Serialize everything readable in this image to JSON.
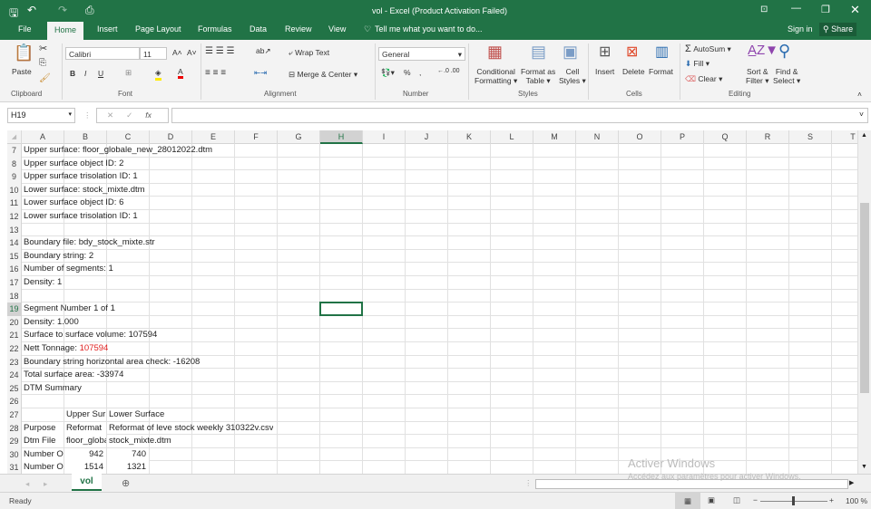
{
  "window": {
    "title": "vol - Excel (Product Activation Failed)"
  },
  "tabs": [
    "File",
    "Home",
    "Insert",
    "Page Layout",
    "Formulas",
    "Data",
    "Review",
    "View"
  ],
  "tell_me": "Tell me what you want to do...",
  "sign_in": "Sign in",
  "share": "Share",
  "ribbon": {
    "clipboard": {
      "paste": "Paste",
      "label": "Clipboard"
    },
    "font": {
      "name": "Calibri",
      "size": "11",
      "bold": "B",
      "italic": "I",
      "underline": "U",
      "label": "Font"
    },
    "alignment": {
      "wrap": "Wrap Text",
      "merge": "Merge & Center",
      "label": "Alignment"
    },
    "number": {
      "format": "General",
      "percent": "%",
      "comma": ",",
      "label": "Number"
    },
    "styles": {
      "conditional": "Conditional",
      "conditional2": "Formatting",
      "format_table": "Format as",
      "format_table2": "Table",
      "cell_styles": "Cell",
      "cell_styles2": "Styles",
      "label": "Styles"
    },
    "cells": {
      "insert": "Insert",
      "delete": "Delete",
      "format": "Format",
      "label": "Cells"
    },
    "editing": {
      "autosum": "AutoSum",
      "fill": "Fill",
      "clear": "Clear",
      "sort": "Sort &",
      "sort2": "Filter",
      "find": "Find &",
      "find2": "Select",
      "label": "Editing"
    }
  },
  "formula_bar": {
    "name_box": "H19",
    "fx": "fx",
    "value": ""
  },
  "columns": [
    "A",
    "B",
    "C",
    "D",
    "E",
    "F",
    "G",
    "H",
    "I",
    "J",
    "K",
    "L",
    "M",
    "N",
    "O",
    "P",
    "Q",
    "R",
    "S",
    "T"
  ],
  "selected": {
    "column": "H",
    "row": "19"
  },
  "rows": [
    {
      "n": "7",
      "cells": [
        {
          "col": 0,
          "text": "Upper surface: floor_globale_new_28012022.dtm"
        }
      ]
    },
    {
      "n": "8",
      "cells": [
        {
          "col": 0,
          "text": "Upper surface object ID: 2"
        }
      ]
    },
    {
      "n": "9",
      "cells": [
        {
          "col": 0,
          "text": "Upper surface trisolation ID: 1"
        }
      ]
    },
    {
      "n": "10",
      "cells": [
        {
          "col": 0,
          "text": "Lower surface: stock_mixte.dtm"
        }
      ]
    },
    {
      "n": "11",
      "cells": [
        {
          "col": 0,
          "text": "Lower surface object ID: 6"
        }
      ]
    },
    {
      "n": "12",
      "cells": [
        {
          "col": 0,
          "text": "Lower surface trisolation ID: 1"
        }
      ]
    },
    {
      "n": "13",
      "cells": []
    },
    {
      "n": "14",
      "cells": [
        {
          "col": 0,
          "text": "Boundary file: bdy_stock_mixte.str"
        }
      ]
    },
    {
      "n": "15",
      "cells": [
        {
          "col": 0,
          "text": "Boundary string: 2"
        }
      ]
    },
    {
      "n": "16",
      "cells": [
        {
          "col": 0,
          "text": "Number of segments: 1"
        }
      ]
    },
    {
      "n": "17",
      "cells": [
        {
          "col": 0,
          "text": "Density: 1"
        }
      ]
    },
    {
      "n": "18",
      "cells": []
    },
    {
      "n": "19",
      "cells": [
        {
          "col": 0,
          "text": "Segment Number 1 of 1"
        }
      ]
    },
    {
      "n": "20",
      "cells": [
        {
          "col": 0,
          "text": "Density: 1.000"
        }
      ]
    },
    {
      "n": "21",
      "cells": [
        {
          "col": 0,
          "text": "Surface to surface volume: 107594"
        }
      ]
    },
    {
      "n": "22",
      "cells": [
        {
          "col": 0,
          "text": "Nett Tonnage: ",
          "red": "107594"
        }
      ]
    },
    {
      "n": "23",
      "cells": [
        {
          "col": 0,
          "text": "Boundary string horizontal area check: -16208"
        }
      ]
    },
    {
      "n": "24",
      "cells": [
        {
          "col": 0,
          "text": "Total surface area: -33974"
        }
      ]
    },
    {
      "n": "25",
      "cells": [
        {
          "col": 0,
          "text": "DTM Summary"
        }
      ]
    },
    {
      "n": "26",
      "cells": []
    },
    {
      "n": "27",
      "cells": [
        {
          "col": 1,
          "text": "Upper Sur",
          "clip": true
        },
        {
          "col": 2,
          "text": "Lower Surface"
        }
      ]
    },
    {
      "n": "28",
      "cells": [
        {
          "col": 0,
          "text": "Purpose",
          "clip": true
        },
        {
          "col": 1,
          "text": "Reformat",
          "clip": true
        },
        {
          "col": 2,
          "text": "Reformat of leve stock weekly 310322v.csv"
        }
      ]
    },
    {
      "n": "29",
      "cells": [
        {
          "col": 0,
          "text": "Dtm File",
          "clip": true
        },
        {
          "col": 1,
          "text": "floor_globale",
          "clip": true
        },
        {
          "col": 2,
          "text": "stock_mixte.dtm"
        }
      ]
    },
    {
      "n": "30",
      "cells": [
        {
          "col": 0,
          "text": "Number Of",
          "clip": true
        },
        {
          "col": 1,
          "text": "942",
          "right": true
        },
        {
          "col": 2,
          "text": "740",
          "right": true
        }
      ]
    },
    {
      "n": "31",
      "cells": [
        {
          "col": 0,
          "text": "Number Of",
          "clip": true
        },
        {
          "col": 1,
          "text": "1514",
          "right": true
        },
        {
          "col": 2,
          "text": "1321",
          "right": true
        }
      ]
    }
  ],
  "sheet_tabs": [
    "vol"
  ],
  "status": {
    "ready": "Ready",
    "zoom": "100 %"
  },
  "watermark": {
    "title": "Activer Windows",
    "subtitle": "Accédez aux paramètres pour activer Windows."
  },
  "colors": {
    "excel_green": "#217346",
    "negative_red": "#e02020",
    "selection": "#217346"
  }
}
